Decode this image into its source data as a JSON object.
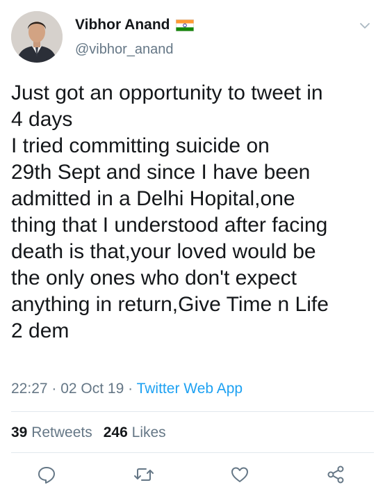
{
  "user": {
    "display_name": "Vibhor Anand",
    "handle": "@vibhor_anand",
    "flag_icon": "india-flag-icon"
  },
  "tweet": {
    "lines": [
      "Just got an opportunity to tweet in",
      "4 days",
      "I tried committing suicide on",
      "29th Sept and since I have been",
      "admitted in a Delhi Hopital,one",
      "thing that I understood after facing",
      "death is that,your loved would be",
      "the only ones who don't expect",
      "anything in return,Give Time n Life",
      "2 dem"
    ],
    "time": "22:27",
    "date": "02 Oct 19",
    "source": "Twitter Web App"
  },
  "stats": {
    "retweets_count": "39",
    "retweets_label": "Retweets",
    "likes_count": "246",
    "likes_label": "Likes"
  },
  "actions": [
    "reply-icon",
    "retweet-icon",
    "like-icon",
    "share-icon"
  ],
  "colors": {
    "text": "#14171a",
    "secondary": "#657786",
    "link": "#1da1f2",
    "divider": "#e1e8ed"
  }
}
